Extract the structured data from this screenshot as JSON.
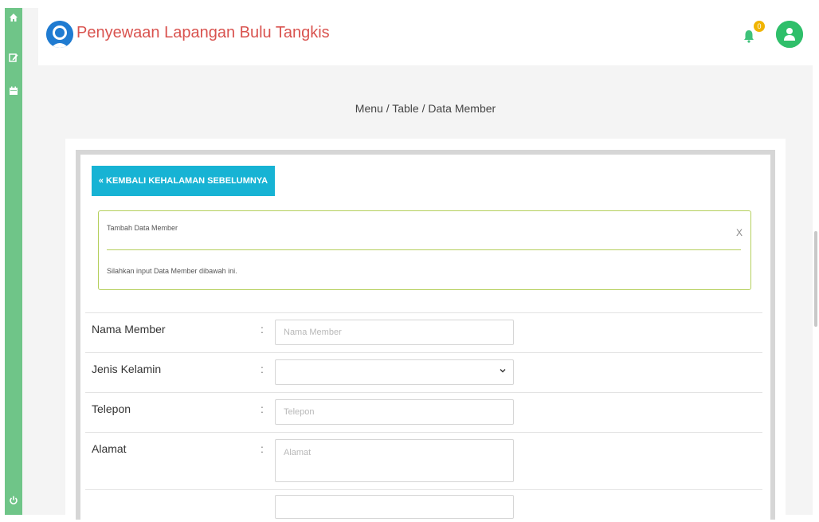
{
  "app": {
    "title": "Penyewaan Lapangan Bulu Tangkis",
    "notification_count": "0"
  },
  "sidebar": {
    "items": [
      {
        "icon": "home-icon"
      },
      {
        "icon": "edit-icon"
      },
      {
        "icon": "calendar-icon"
      },
      {
        "icon": "power-icon"
      }
    ]
  },
  "breadcrumb": "Menu / Table / Data Member",
  "back_button": {
    "icon": "double-chevron-left-icon",
    "label": "KEMBALI KEHALAMAN SEBELUMNYA"
  },
  "alert": {
    "title": "Tambah Data Member",
    "close": "X",
    "body": "Silahkan input Data Member dibawah ini."
  },
  "form": {
    "colon": ":",
    "fields": [
      {
        "label": "Nama Member",
        "placeholder": "Nama Member",
        "value": ""
      },
      {
        "label": "Jenis Kelamin",
        "value": ""
      },
      {
        "label": "Telepon",
        "placeholder": "Telepon",
        "value": ""
      },
      {
        "label": "Alamat",
        "placeholder": "Alamat",
        "value": ""
      }
    ]
  },
  "colors": {
    "sidebar": "#6fc588",
    "title": "#d9534f",
    "button": "#17b3d4",
    "alert_border": "#b5cf5c",
    "avatar": "#2fbf6a",
    "badge": "#f0b400"
  }
}
